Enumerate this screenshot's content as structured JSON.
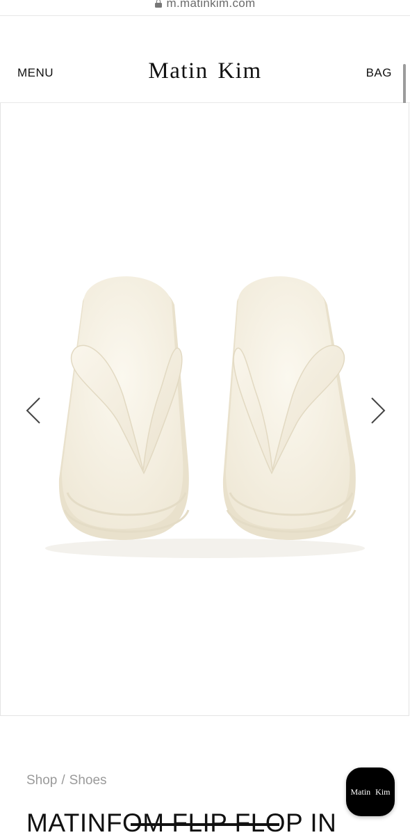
{
  "browser": {
    "url": "m.matinkim.com"
  },
  "header": {
    "menu_label": "MENU",
    "brand": "Matin Kim",
    "bag_label": "BAG"
  },
  "gallery": {
    "image_subject": "white platform flip flops",
    "prev_icon": "chevron-left-icon",
    "next_icon": "chevron-right-icon"
  },
  "breadcrumb": {
    "items": [
      "Shop",
      "Shoes"
    ],
    "separator": "/"
  },
  "product": {
    "title": "MATINFOM FLIP FLOP IN"
  },
  "chat_button": {
    "label": "Matin Kim"
  },
  "colors": {
    "sandal": "#f4efe2",
    "sandal_shade": "#e6dfcd",
    "accent": "#000000",
    "breadcrumb": "#9a9a9a"
  }
}
